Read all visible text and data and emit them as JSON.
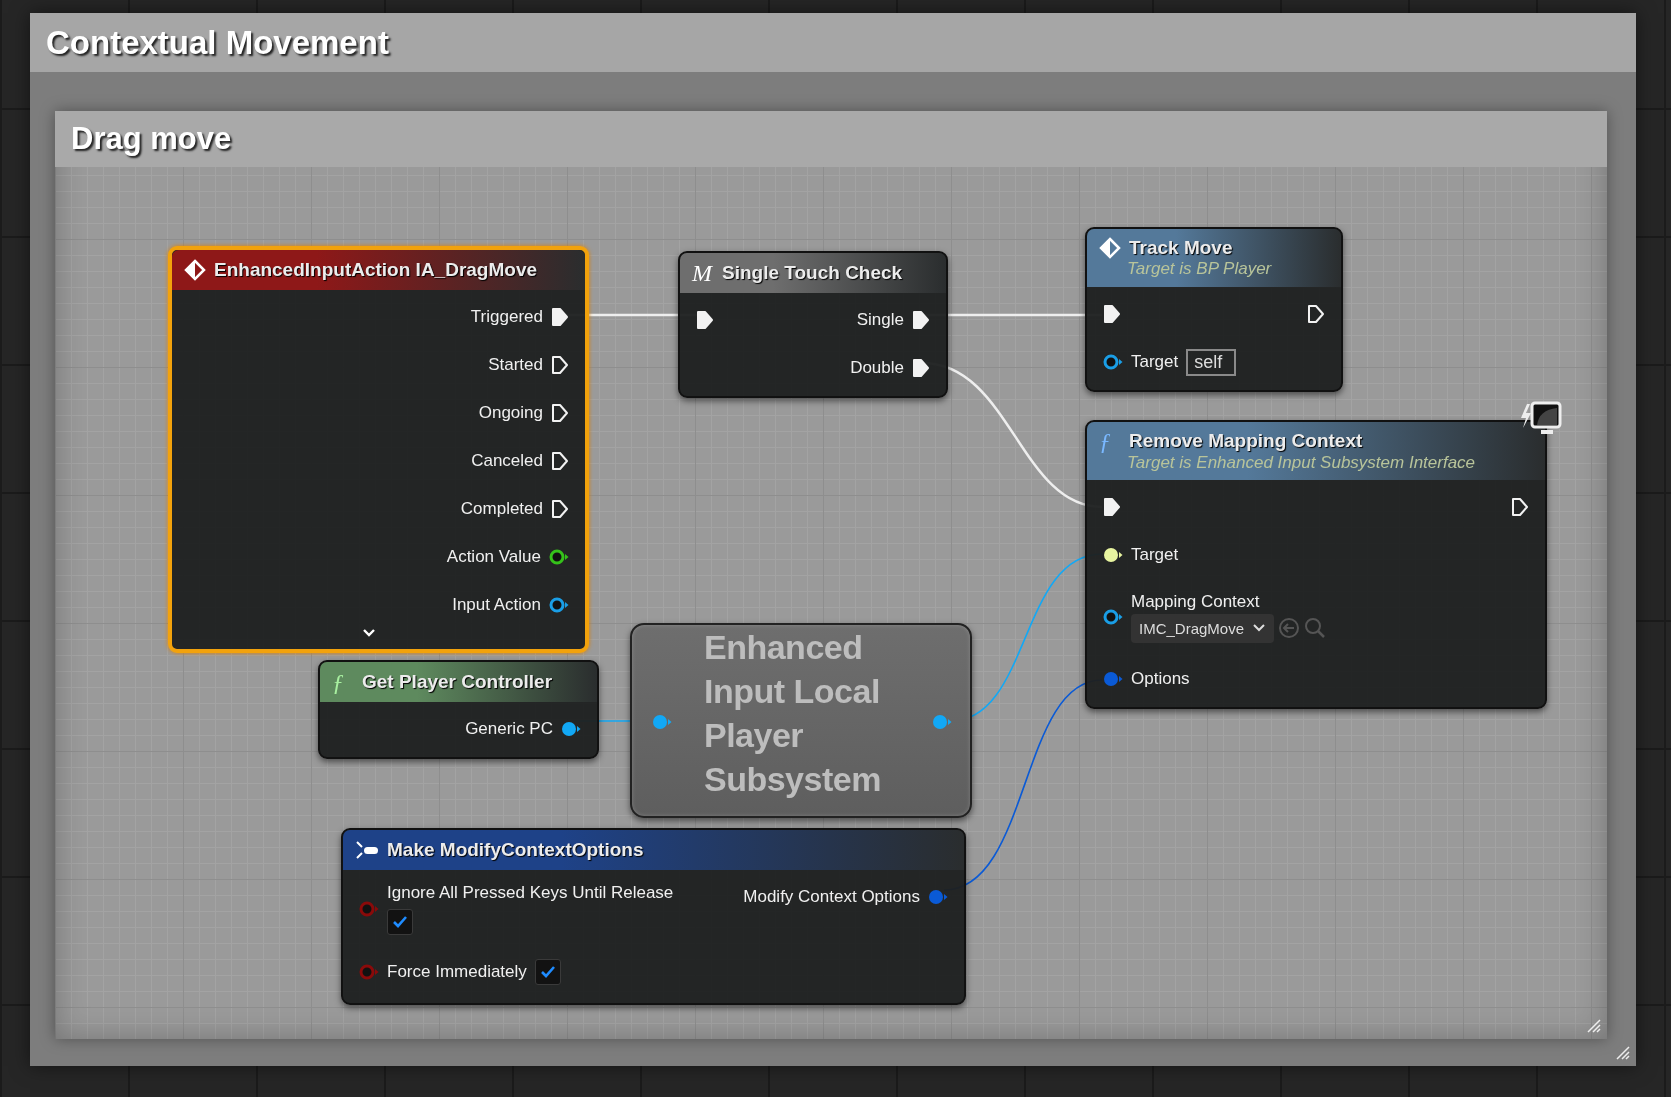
{
  "outer_comment": {
    "title": "Contextual Movement"
  },
  "inner_comment": {
    "title": "Drag move"
  },
  "nodes": [
    {
      "kind": "event",
      "title": "EnhancedInputAction IA_DragMove",
      "color": "#8e1818",
      "selected": true,
      "outputs": [
        {
          "kind": "exec",
          "label": "Triggered",
          "connected": true
        },
        {
          "kind": "exec",
          "label": "Started",
          "connected": false
        },
        {
          "kind": "exec",
          "label": "Ongoing",
          "connected": false
        },
        {
          "kind": "exec",
          "label": "Canceled",
          "connected": false
        },
        {
          "kind": "exec",
          "label": "Completed",
          "connected": false
        },
        {
          "kind": "data",
          "label": "Action Value",
          "color": "#35c21a",
          "connected": false
        },
        {
          "kind": "data",
          "label": "Input Action",
          "color": "#1a9ee6",
          "connected": false
        }
      ]
    },
    {
      "kind": "macro",
      "glyph": "M",
      "title": "Single Touch Check",
      "color": "#6e6e6e",
      "selected": false,
      "inputs": [
        {
          "kind": "exec",
          "connected": true
        }
      ],
      "outputs": [
        {
          "kind": "exec",
          "label": "Single",
          "connected": true
        },
        {
          "kind": "exec",
          "label": "Double",
          "connected": true
        }
      ]
    },
    {
      "kind": "custom-event",
      "title": "Track Move",
      "subtitle": "Target is BP Player",
      "color": "#54799a",
      "selected": false,
      "inputs": [
        {
          "kind": "exec",
          "connected": true
        },
        {
          "kind": "data",
          "label": "Target",
          "color": "#1a9ee6",
          "connected": false,
          "default": "self"
        }
      ],
      "outputs": [
        {
          "kind": "exec",
          "connected": false
        }
      ]
    },
    {
      "kind": "function",
      "glyph": "ƒ",
      "title": "Remove Mapping Context",
      "subtitle": "Target is Enhanced Input Subsystem Interface",
      "color": "#54799a",
      "selected": false,
      "client_only": true,
      "inputs": [
        {
          "kind": "exec",
          "connected": true
        },
        {
          "kind": "data",
          "label": "Target",
          "color": "#e8f5a0",
          "connected": true
        },
        {
          "kind": "asset",
          "label": "Mapping Context",
          "color": "#1a9ee6",
          "connected": false,
          "value": "IMC_DragMove"
        },
        {
          "kind": "data",
          "label": "Options",
          "color": "#0a5ad6",
          "connected": true
        }
      ],
      "outputs": [
        {
          "kind": "exec",
          "connected": false
        }
      ]
    },
    {
      "kind": "function",
      "glyph": "ƒ",
      "title": "Get Player Controller",
      "color": "#5e8a5e",
      "selected": false,
      "outputs": [
        {
          "kind": "data",
          "label": "Generic PC",
          "color": "#12a8f5",
          "connected": true
        }
      ]
    },
    {
      "kind": "compact",
      "title": "Enhanced Input Local Player Subsystem",
      "selected": false,
      "inputs": [
        {
          "kind": "data",
          "color": "#12a8f5",
          "connected": true
        }
      ],
      "outputs": [
        {
          "kind": "data",
          "color": "#12a8f5",
          "connected": true
        }
      ]
    },
    {
      "kind": "struct",
      "title": "Make ModifyContextOptions",
      "color": "#1e4288",
      "selected": false,
      "inputs": [
        {
          "kind": "bool",
          "label": "Ignore All Pressed Keys Until Release",
          "color": "#8a0a0a",
          "connected": false,
          "checked": true
        },
        {
          "kind": "bool",
          "label": "Force Immediately",
          "color": "#8a0a0a",
          "connected": false,
          "checked": true
        }
      ],
      "outputs": [
        {
          "kind": "data",
          "label": "Modify Context Options",
          "color": "#0a5ad6",
          "connected": true
        }
      ]
    }
  ]
}
